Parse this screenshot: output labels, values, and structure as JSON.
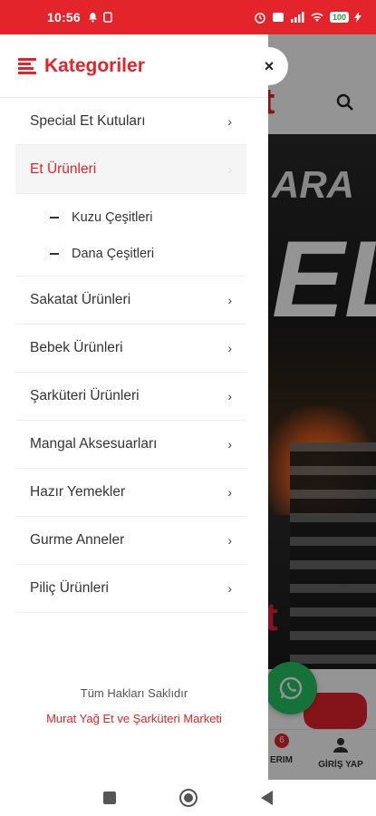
{
  "status_bar": {
    "time": "10:56",
    "battery": "100",
    "colors": {
      "background": "#e3242b"
    }
  },
  "drawer": {
    "title": "Kategoriler",
    "items": [
      {
        "label": "Special Et Kutuları",
        "chevron": "›"
      },
      {
        "label": "Et Ürünleri",
        "chevron": "›",
        "active": true,
        "children": [
          {
            "label": "Kuzu Çeşitleri"
          },
          {
            "label": "Dana Çeşitleri"
          }
        ]
      },
      {
        "label": "Sakatat Ürünleri",
        "chevron": "›"
      },
      {
        "label": "Bebek Ürünleri",
        "chevron": "›"
      },
      {
        "label": "Şarküteri Ürünleri",
        "chevron": "›"
      },
      {
        "label": "Mangal Aksesuarları",
        "chevron": "›"
      },
      {
        "label": "Hazır Yemekler",
        "chevron": "›"
      },
      {
        "label": "Gurme Anneler",
        "chevron": "›"
      },
      {
        "label": "Piliç Ürünleri",
        "chevron": "›"
      }
    ],
    "footer": {
      "rights": "Tüm Hakları Saklıdır",
      "company": "Murat Yağ Et ve Şarküteri Marketi"
    },
    "close_symbol": "×"
  },
  "background": {
    "logo_fragment": "t",
    "banner_text_top": "ARA",
    "banner_text_big": "EL",
    "banner_text_bottom": "t",
    "cart_badge": "6",
    "nav_fragment_label": "ERIM",
    "login_label": "GİRİŞ YAP"
  },
  "colors": {
    "accent": "#e3242b",
    "whatsapp": "#25c462"
  }
}
